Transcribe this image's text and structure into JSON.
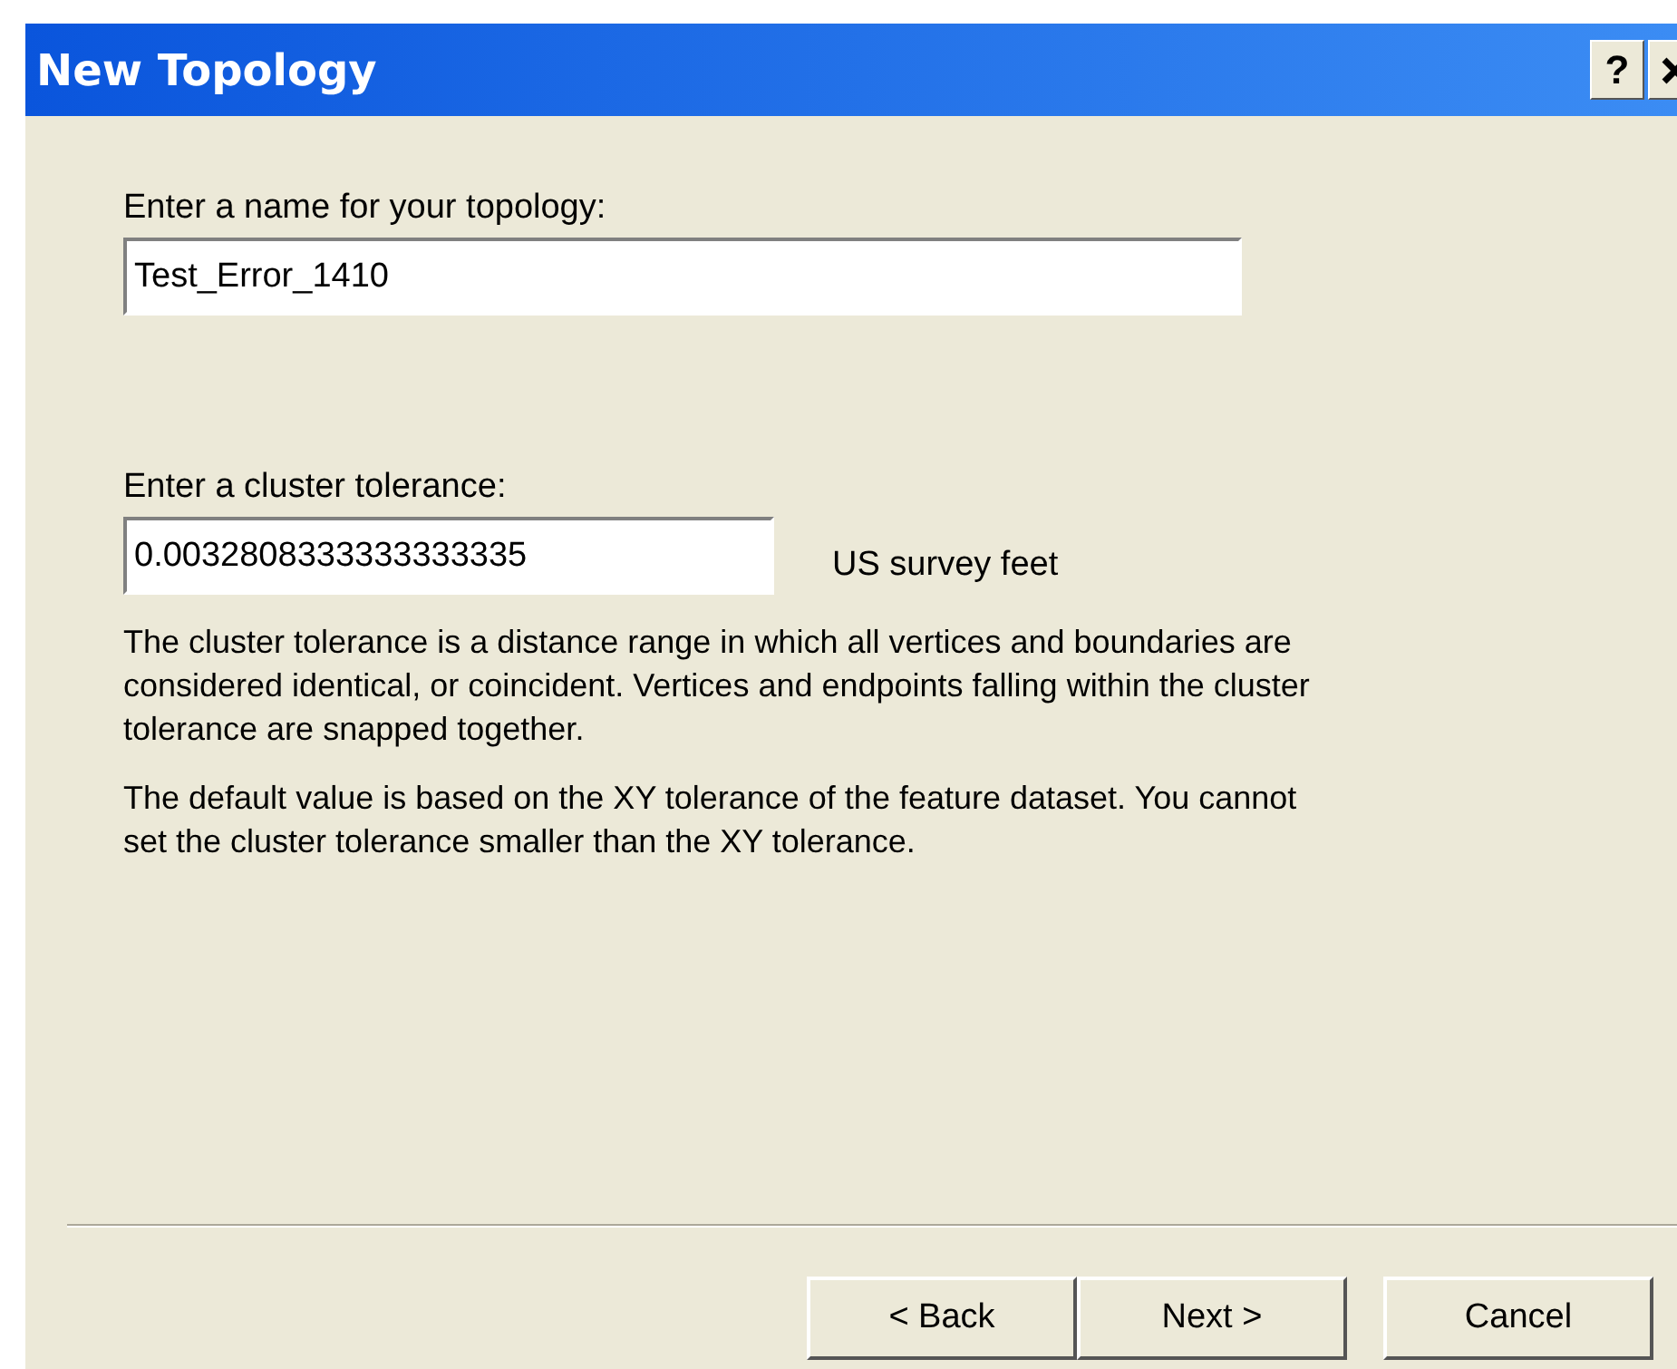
{
  "window": {
    "title": "New Topology",
    "help_button": "?"
  },
  "name_field": {
    "label": "Enter a name for your topology:",
    "value": "Test_Error_1410"
  },
  "tolerance_field": {
    "label": "Enter a cluster tolerance:",
    "value": "0.0032808333333333335",
    "unit": "US survey feet"
  },
  "paragraphs": [
    "The cluster tolerance is a distance range in which all vertices and boundaries are considered identical, or coincident. Vertices and endpoints falling within the cluster tolerance are snapped together.",
    "The default value is based on the XY tolerance of the feature dataset. You cannot set the cluster tolerance smaller than the XY tolerance."
  ],
  "buttons": [
    {
      "label": "< Back",
      "kind": "nav"
    },
    {
      "label": "Next >",
      "kind": "nav"
    },
    {
      "label": "Cancel",
      "kind": "cancel"
    }
  ]
}
